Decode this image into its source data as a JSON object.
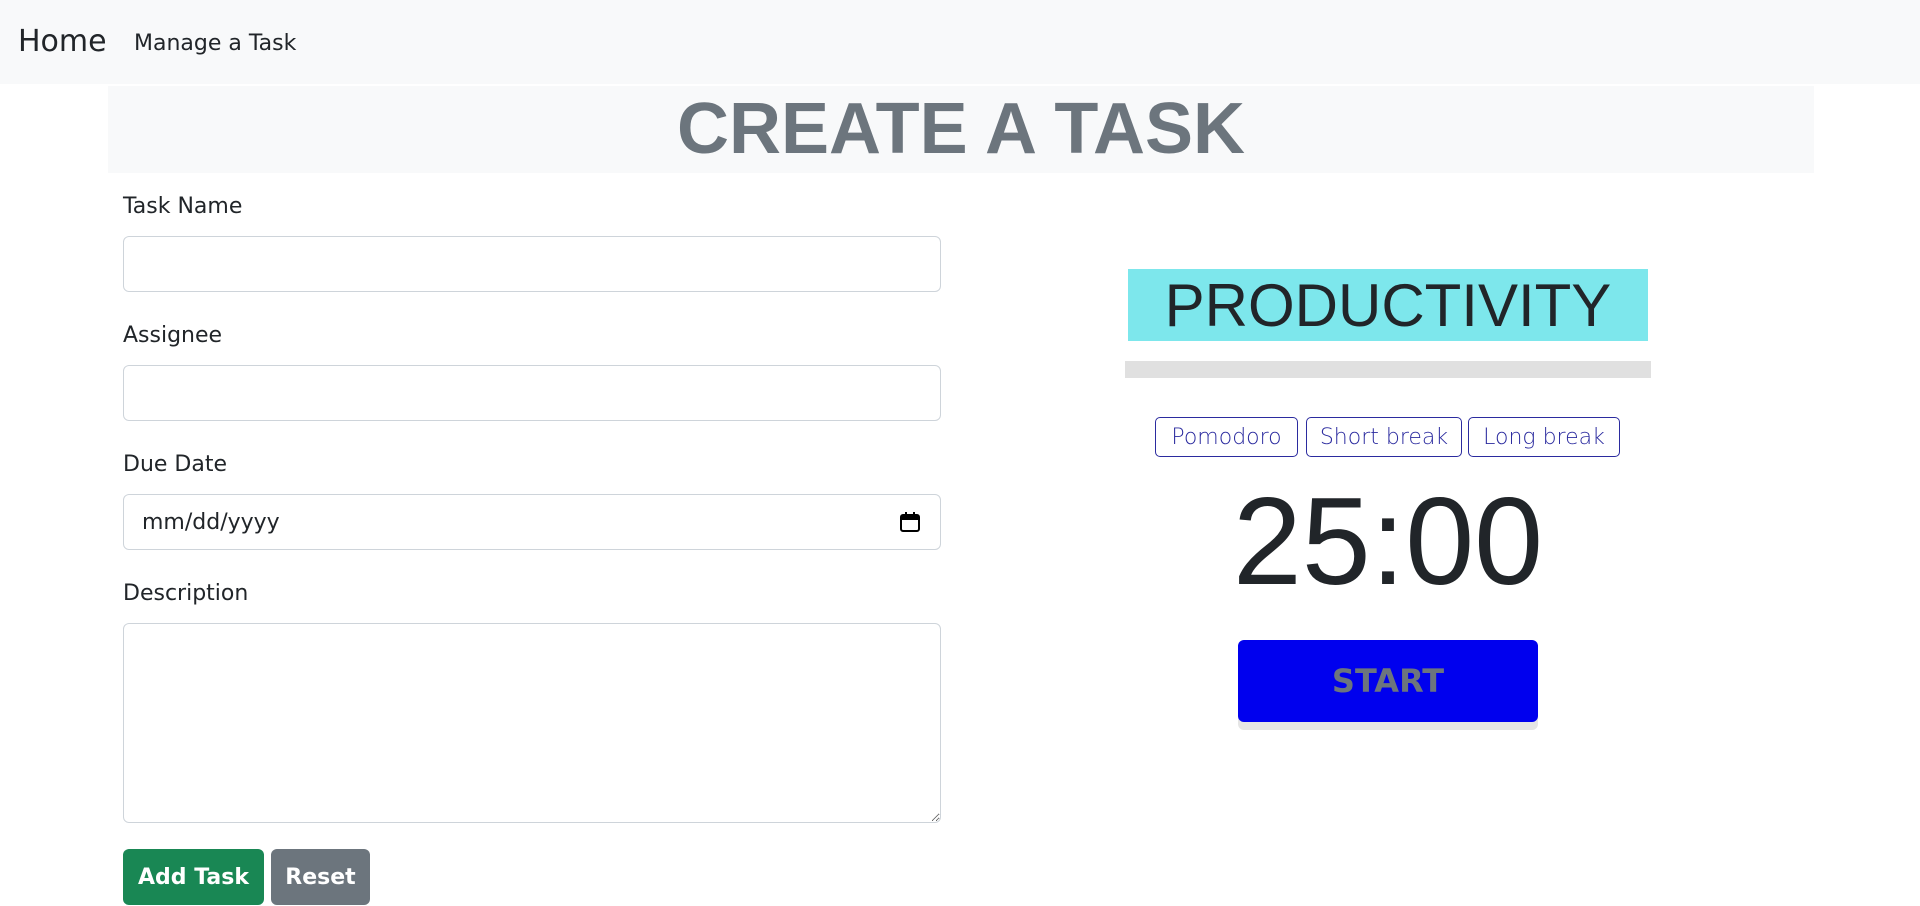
{
  "nav": {
    "brand": "Home",
    "manage_link": "Manage a Task"
  },
  "page": {
    "title": "CREATE A TASK"
  },
  "form": {
    "task_name": {
      "label": "Task Name",
      "value": ""
    },
    "assignee": {
      "label": "Assignee",
      "value": ""
    },
    "due_date": {
      "label": "Due Date",
      "placeholder": "mm/dd/yyyy"
    },
    "description": {
      "label": "Description",
      "value": ""
    },
    "add_button": "Add Task",
    "reset_button": "Reset"
  },
  "timer": {
    "banner": "PRODUCTIVITY",
    "progress_fraction": 0,
    "modes": [
      "Pomodoro",
      "Short break",
      "Long break"
    ],
    "time": "25:00",
    "start_label": "START"
  },
  "colors": {
    "banner": "#7de7ec",
    "start_button": "#0000ee",
    "add_button": "#198754",
    "reset_button": "#6c757d",
    "mode_button_border": "#2b2b9f"
  }
}
